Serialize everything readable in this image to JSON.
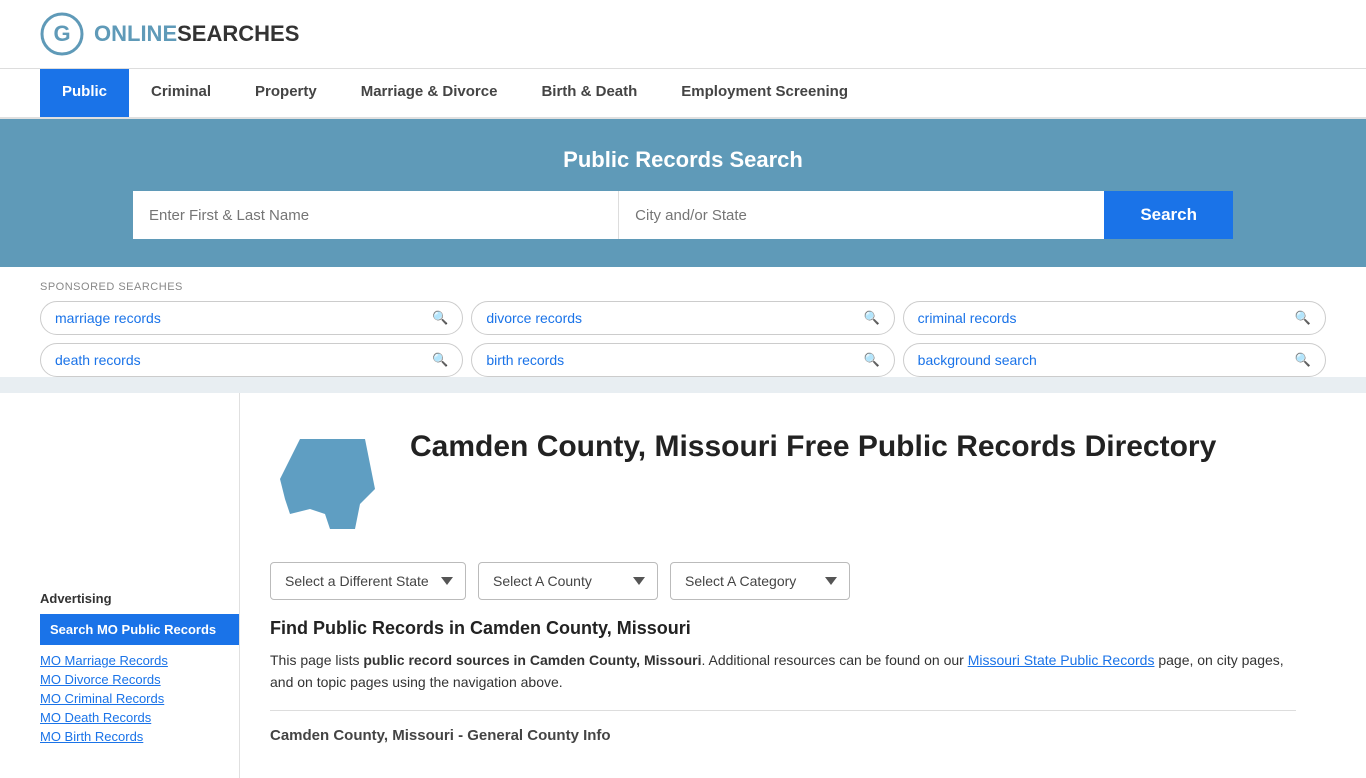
{
  "header": {
    "logo_text_plain": "ONLINE",
    "logo_text_colored": "SEARCHES",
    "nav_items": [
      {
        "label": "Public",
        "active": true
      },
      {
        "label": "Criminal",
        "active": false
      },
      {
        "label": "Property",
        "active": false
      },
      {
        "label": "Marriage & Divorce",
        "active": false
      },
      {
        "label": "Birth & Death",
        "active": false
      },
      {
        "label": "Employment Screening",
        "active": false
      }
    ]
  },
  "search_banner": {
    "title": "Public Records Search",
    "name_placeholder": "Enter First & Last Name",
    "location_placeholder": "City and/or State",
    "search_button": "Search"
  },
  "sponsored": {
    "label": "SPONSORED SEARCHES",
    "tags": [
      "marriage records",
      "divorce records",
      "criminal records",
      "death records",
      "birth records",
      "background search"
    ]
  },
  "directory": {
    "title": "Camden County, Missouri Free Public Records Directory",
    "state_dropdown_label": "Select a Different State",
    "county_dropdown_label": "Select A County",
    "category_dropdown_label": "Select A Category"
  },
  "find_records": {
    "title": "Find Public Records in Camden County, Missouri",
    "description_before": "This page lists ",
    "description_bold": "public record sources in Camden County, Missouri",
    "description_after": ". Additional resources can be found on our ",
    "link_text": "Missouri State Public Records",
    "description_end": " page, on city pages, and on topic pages using the navigation above."
  },
  "general_info": {
    "title": "Camden County, Missouri - General County Info"
  },
  "sidebar": {
    "ad_label": "Advertising",
    "ad_highlight": "Search MO Public Records",
    "links": [
      "MO Marriage Records",
      "MO Divorce Records",
      "MO Criminal Records",
      "MO Death Records",
      "MO Birth Records"
    ]
  },
  "colors": {
    "brand_blue": "#1a73e8",
    "banner_bg": "#5f9ab8",
    "nav_active": "#1a73e8",
    "map_fill": "#5f9ec2"
  }
}
